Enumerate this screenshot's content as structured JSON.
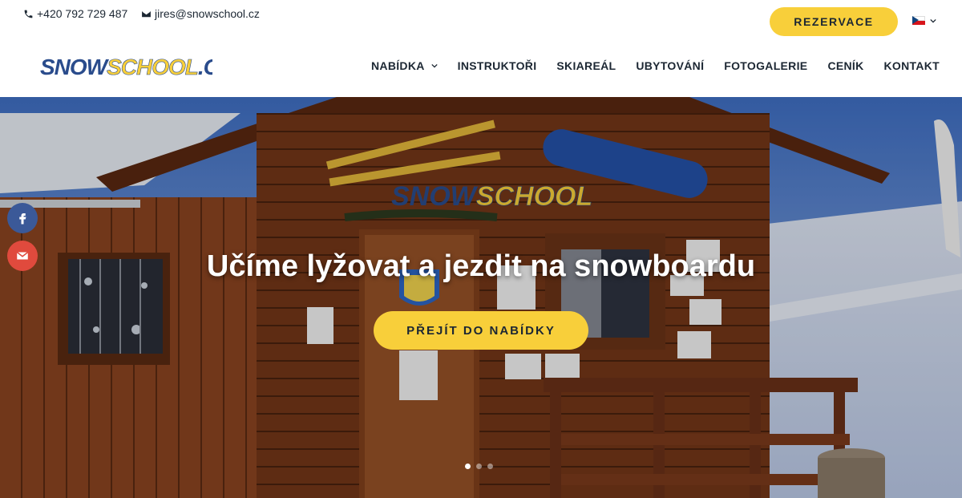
{
  "topbar": {
    "phone": "+420 792 729 487",
    "email": "jires@snowschool.cz",
    "phone_icon": "phone-icon",
    "email_icon": "envelope-icon",
    "reservation_label": "REZERVACE",
    "language": "cs"
  },
  "logo": {
    "part1": "SNOW",
    "part2": "SCHOOL",
    "part3": ".CZ"
  },
  "nav": {
    "items": [
      {
        "label": "NABÍDKA",
        "has_dropdown": true
      },
      {
        "label": "INSTRUKTOŘI"
      },
      {
        "label": "SKIAREÁL"
      },
      {
        "label": "UBYTOVÁNÍ"
      },
      {
        "label": "FOTOGALERIE"
      },
      {
        "label": "CENÍK"
      },
      {
        "label": "KONTAKT"
      }
    ]
  },
  "hero": {
    "title": "Učíme lyžovat a jezdit na snowboardu",
    "cta_label": "PŘEJÍT DO NABÍDKY",
    "sign_part1": "SNOW",
    "sign_part2": "SCHOOL",
    "slides": 3,
    "active_slide": 1
  },
  "social": {
    "facebook_icon": "facebook-icon",
    "email_icon": "mail-icon"
  },
  "colors": {
    "accent": "#f8cf3a",
    "text": "#1c2733",
    "facebook": "#3b5998",
    "mail": "#e04a3d",
    "logo_blue": "#2a4c8c"
  }
}
